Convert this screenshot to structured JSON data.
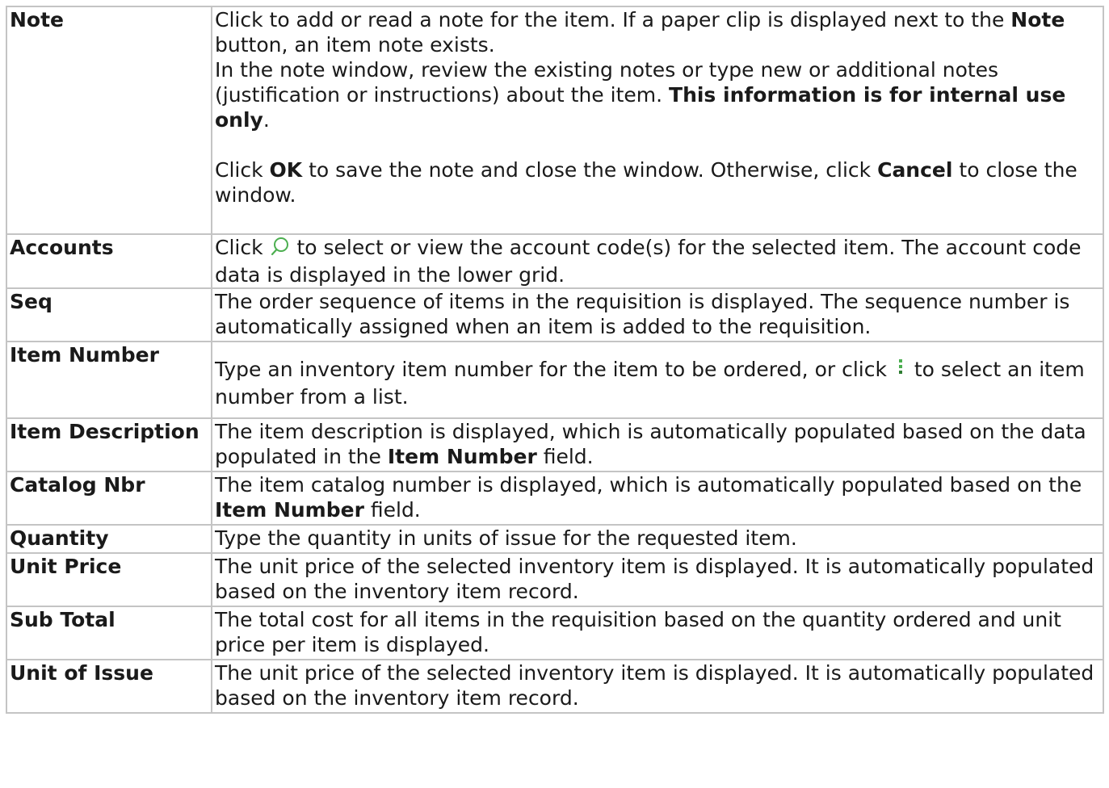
{
  "rows": {
    "note": {
      "term": "Note",
      "p1_a": "Click to add or read a note for the item. If a paper clip is displayed next to the ",
      "p1_b": "Note",
      "p1_c": " button, an item note exists.",
      "p2_a": "In the note window, review the existing notes or type new or additional notes (justification or instructions) about the item. ",
      "p2_b": "This information is for internal use only",
      "p2_c": ".",
      "p3_a": "Click ",
      "p3_b": "OK",
      "p3_c": " to save the note and close the window. Otherwise, click ",
      "p3_d": "Cancel",
      "p3_e": " to close the window."
    },
    "accounts": {
      "term": "Accounts",
      "d_a": "Click ",
      "d_b": " to select or view the account code(s) for the selected item. The account code data is displayed in the lower grid.",
      "icon": "search-icon"
    },
    "seq": {
      "term": "Seq",
      "d": "The order sequence of items in the requisition is displayed. The sequence number is automatically assigned when an item is added to the requisition."
    },
    "item_number": {
      "term": "Item Number",
      "d_a": "Type an inventory item number for the item to be ordered, or click ",
      "d_b": " to select an item number from a list.",
      "icon": "vertical-ellipsis-icon"
    },
    "item_description": {
      "term": "Item Description",
      "d_a": "The item description is displayed, which is automatically populated based on the data populated in the ",
      "d_b": "Item Number",
      "d_c": " field."
    },
    "catalog_nbr": {
      "term": "Catalog Nbr",
      "d_a": "The item catalog number is displayed, which is automatically populated based on the ",
      "d_b": "Item Number",
      "d_c": " field."
    },
    "quantity": {
      "term": "Quantity",
      "d": "Type the quantity in units of issue for the requested item."
    },
    "unit_price": {
      "term": "Unit Price",
      "d": "The unit price of the selected inventory item is displayed. It is automatically populated based on the inventory item record."
    },
    "sub_total": {
      "term": "Sub Total",
      "d": "The total cost for all items in the requisition based on the quantity ordered and unit price per item is displayed."
    },
    "unit_of_issue": {
      "term": "Unit of Issue",
      "d": "The unit price of the selected inventory item is displayed. It is automatically populated based on the inventory item record."
    }
  },
  "colors": {
    "border": "#c4c4c4",
    "text": "#1a1a1a",
    "icon_green": "#4caf50"
  }
}
